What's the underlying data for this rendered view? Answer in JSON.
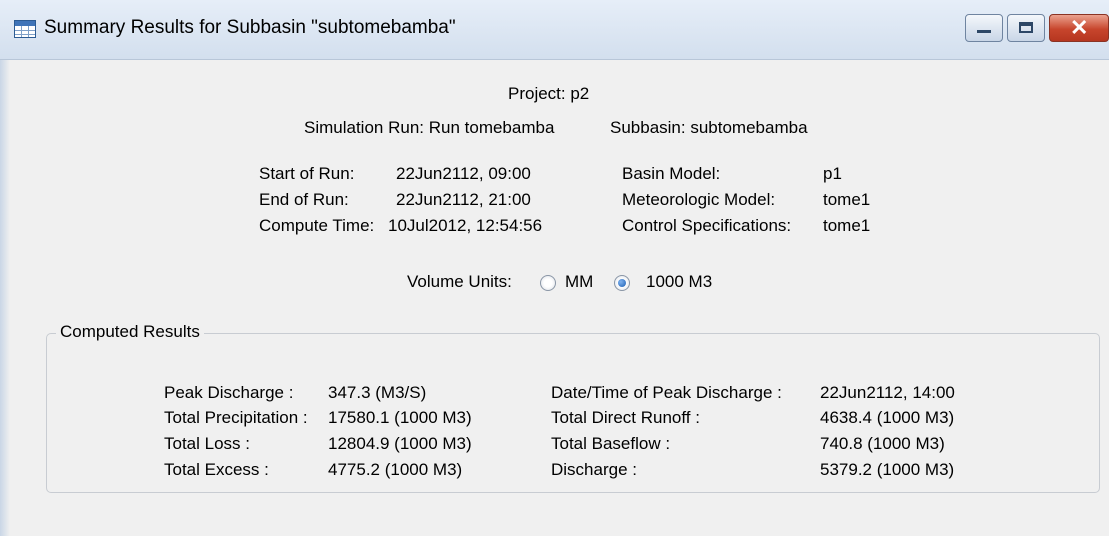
{
  "window": {
    "title": "Summary Results for Subbasin \"subtomebamba\""
  },
  "header": {
    "project": "Project: p2",
    "simulation_run": "Simulation Run: Run tomebamba",
    "subbasin": "Subbasin: subtomebamba"
  },
  "run_info": {
    "start_label": "Start of Run:",
    "start_value": "22Jun2112, 09:00",
    "end_label": "End of Run:",
    "end_value": "22Jun2112, 21:00",
    "compute_label": "Compute Time:",
    "compute_value": "10Jul2012, 12:54:56",
    "basin_label": "Basin Model:",
    "basin_value": "p1",
    "met_label": "Meteorologic Model:",
    "met_value": "tome1",
    "control_label": "Control Specifications:",
    "control_value": "tome1"
  },
  "units": {
    "label": "Volume Units:",
    "options": [
      "MM",
      "1000 M3"
    ],
    "selected": "1000 M3"
  },
  "results": {
    "group_title": "Computed Results",
    "left": [
      {
        "label": "Peak Discharge :",
        "value": "347.3 (M3/S)"
      },
      {
        "label": "Total Precipitation :",
        "value": "17580.1 (1000 M3)"
      },
      {
        "label": "Total Loss :",
        "value": "12804.9 (1000 M3)"
      },
      {
        "label": "Total Excess :",
        "value": "4775.2 (1000 M3)"
      }
    ],
    "right": [
      {
        "label": "Date/Time of Peak Discharge :",
        "value": "22Jun2112, 14:00"
      },
      {
        "label": "Total Direct Runoff :",
        "value": "4638.4 (1000 M3)"
      },
      {
        "label": "Total Baseflow :",
        "value": "740.8 (1000 M3)"
      },
      {
        "label": "Discharge :",
        "value": "5379.2 (1000 M3)"
      }
    ]
  }
}
